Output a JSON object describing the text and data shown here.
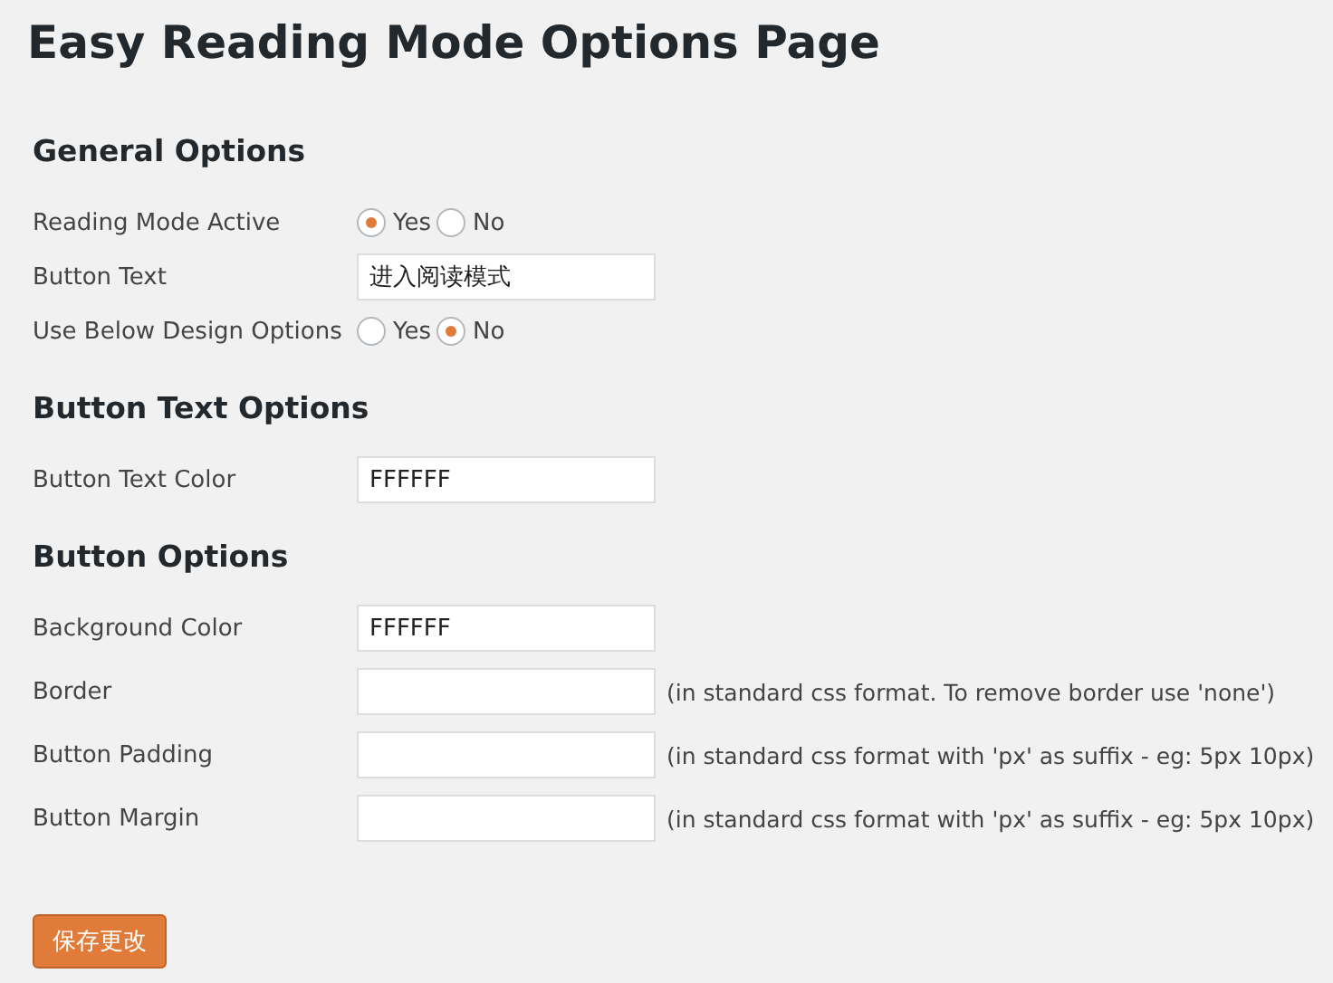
{
  "title": "Easy Reading Mode Options Page",
  "sections": [
    {
      "heading": "General Options",
      "rows": [
        {
          "kind": "radio",
          "label": "Reading Mode Active",
          "options": [
            {
              "label": "Yes",
              "selected": true
            },
            {
              "label": "No",
              "selected": false
            }
          ]
        },
        {
          "kind": "text",
          "label": "Button Text",
          "value": "进入阅读模式"
        },
        {
          "kind": "radio",
          "label": "Use Below Design Options",
          "options": [
            {
              "label": "Yes",
              "selected": false
            },
            {
              "label": "No",
              "selected": true
            }
          ]
        }
      ]
    },
    {
      "heading": "Button Text Options",
      "rows": [
        {
          "kind": "text",
          "label": "Button Text Color",
          "value": "FFFFFF"
        }
      ]
    },
    {
      "heading": "Button Options",
      "rows": [
        {
          "kind": "text",
          "label": "Background Color",
          "value": "FFFFFF"
        },
        {
          "kind": "text",
          "label": "Border",
          "hint": "(in standard css format. To remove border use 'none')"
        },
        {
          "kind": "text",
          "label": "Button Padding",
          "hint": "(in standard css format with 'px' as suffix - eg: 5px 10px)"
        },
        {
          "kind": "text",
          "label": "Button Margin",
          "hint": "(in standard css format with 'px' as suffix - eg: 5px 10px)"
        }
      ]
    }
  ],
  "save_button": "保存更改"
}
